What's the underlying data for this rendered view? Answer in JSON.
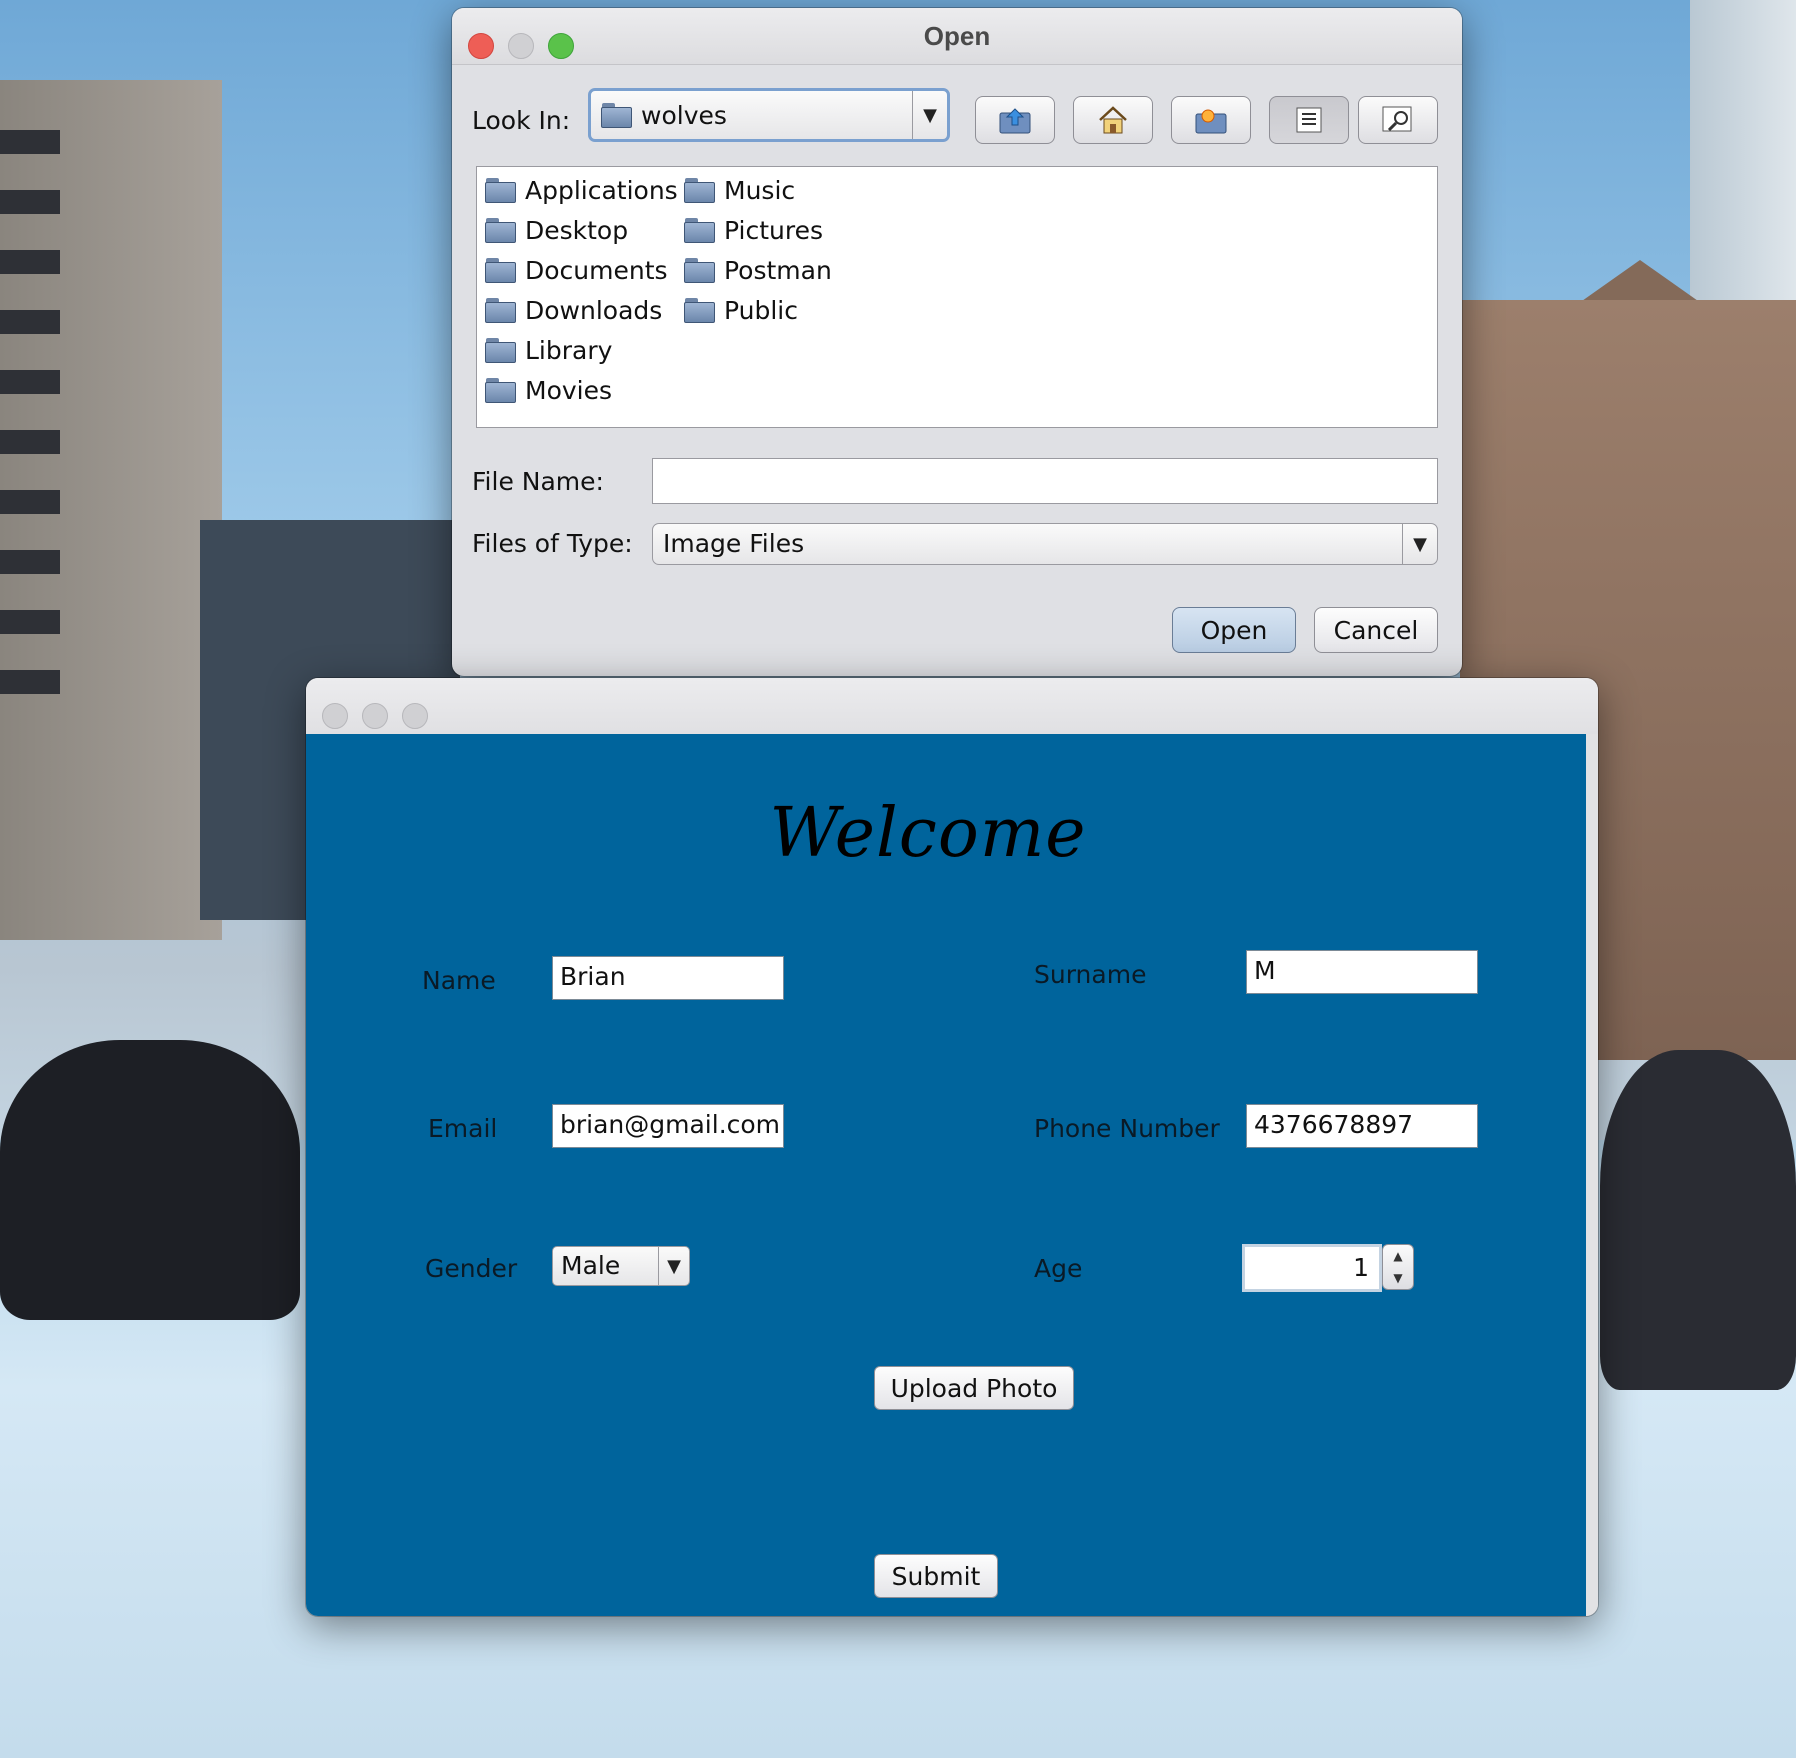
{
  "open_dialog": {
    "title": "Open",
    "look_in_label": "Look In:",
    "look_in_value": "wolves",
    "toolbar_icons": [
      "up-one-level-icon",
      "home-icon",
      "new-folder-icon",
      "list-view-icon",
      "details-view-icon"
    ],
    "files_col1": [
      "Applications",
      "Desktop",
      "Documents",
      "Downloads",
      "Library",
      "Movies"
    ],
    "files_col2": [
      "Music",
      "Pictures",
      "Postman",
      "Public"
    ],
    "file_name_label": "File Name:",
    "file_name_value": "",
    "files_of_type_label": "Files of Type:",
    "files_of_type_value": "Image Files",
    "open_button": "Open",
    "cancel_button": "Cancel"
  },
  "form": {
    "heading": "Welcome",
    "name_label": "Name",
    "name_value": "Brian",
    "surname_label": "Surname",
    "surname_value": "M",
    "email_label": "Email",
    "email_value": "brian@gmail.com",
    "phone_label": "Phone Number",
    "phone_value": "4376678897",
    "gender_label": "Gender",
    "gender_value": "Male",
    "age_label": "Age",
    "age_value": "1",
    "upload_button": "Upload Photo",
    "submit_button": "Submit"
  },
  "colors": {
    "form_background": "#00649c",
    "close_red": "#ee5e56",
    "minimize_yellow_inactive": "#c9c9cc",
    "zoom_green": "#5ac24a"
  }
}
